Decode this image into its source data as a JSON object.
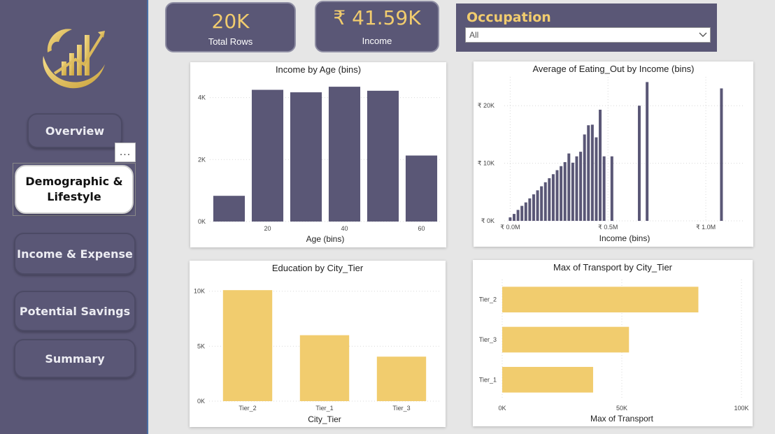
{
  "sidebar": {
    "logo": "lion-growth-chart-logo",
    "nav": [
      {
        "label": "Overview",
        "active": false
      },
      {
        "label": "Demographic & Lifestyle",
        "active": true
      },
      {
        "label": "Income & Expense",
        "active": false
      },
      {
        "label": "Potential Savings",
        "active": false
      },
      {
        "label": "Summary",
        "active": false
      }
    ],
    "more_label": "..."
  },
  "kpis": {
    "rows": {
      "value": "20K",
      "label": "Total Rows"
    },
    "income": {
      "value": "₹ 41.59K",
      "label": "Income"
    }
  },
  "slicer": {
    "title": "Occupation",
    "selected": "All",
    "icon": "chevron-down-icon"
  },
  "colors": {
    "primary": "#5a5776",
    "accent": "#f1cc6e",
    "bar_dark": "#5a5776",
    "bar_gold": "#f1cc6e"
  },
  "chart_data": [
    {
      "id": "income_by_age",
      "type": "bar",
      "title": "Income by Age (bins)",
      "xlabel": "Age (bins)",
      "x": [
        10,
        20,
        30,
        40,
        50,
        60
      ],
      "values": [
        830,
        4250,
        4170,
        4350,
        4220,
        2130
      ],
      "xticks": [
        "20",
        "40",
        "60"
      ],
      "xtick_values": [
        20,
        40,
        60
      ],
      "yticks": [
        "0K",
        "2K",
        "4K"
      ],
      "ytick_values": [
        0,
        2000,
        4000
      ],
      "xlim": [
        5,
        65
      ],
      "ylim": [
        0,
        4600
      ]
    },
    {
      "id": "eating_out_by_income",
      "type": "bar",
      "title": "Average of Eating_Out by Income (bins)",
      "xlabel": "Income (bins)",
      "x": [
        0,
        0.02,
        0.04,
        0.06,
        0.08,
        0.1,
        0.12,
        0.14,
        0.16,
        0.18,
        0.2,
        0.22,
        0.24,
        0.26,
        0.28,
        0.3,
        0.32,
        0.34,
        0.36,
        0.38,
        0.4,
        0.42,
        0.44,
        0.46,
        0.48,
        0.52,
        0.66,
        0.7,
        1.08
      ],
      "values": [
        600,
        1200,
        1900,
        2600,
        3200,
        3900,
        4600,
        5300,
        6000,
        6700,
        7400,
        8100,
        8800,
        9500,
        10200,
        11700,
        10100,
        11200,
        12000,
        15000,
        16600,
        16700,
        14500,
        19300,
        11200,
        11200,
        20000,
        24100,
        23000
      ],
      "xticks": [
        "₹ 0.0M",
        "₹ 0.5M",
        "₹ 1.0M"
      ],
      "xtick_values": [
        0,
        0.5,
        1.0
      ],
      "yticks": [
        "₹ 0K",
        "₹ 10K",
        "₹ 20K"
      ],
      "ytick_values": [
        0,
        10000,
        20000
      ],
      "xlim": [
        -0.03,
        1.2
      ],
      "ylim": [
        0,
        25000
      ]
    },
    {
      "id": "education_by_city_tier",
      "type": "bar",
      "title": "Education by City_Tier",
      "xlabel": "City_Tier",
      "categories": [
        "Tier_2",
        "Tier_1",
        "Tier_3"
      ],
      "values": [
        10100,
        6000,
        4050
      ],
      "yticks": [
        "0K",
        "5K",
        "10K"
      ],
      "ytick_values": [
        0,
        5000,
        10000
      ],
      "ylim": [
        0,
        11000
      ]
    },
    {
      "id": "transport_by_city_tier",
      "type": "bar",
      "orientation": "horizontal",
      "title": "Max of Transport by City_Tier",
      "xlabel": "Max of Transport",
      "categories": [
        "Tier_2",
        "Tier_3",
        "Tier_1"
      ],
      "values": [
        82000,
        53000,
        38000
      ],
      "xticks": [
        "0K",
        "50K",
        "100K"
      ],
      "xtick_values": [
        0,
        50000,
        100000
      ],
      "xlim": [
        0,
        100000
      ]
    }
  ]
}
